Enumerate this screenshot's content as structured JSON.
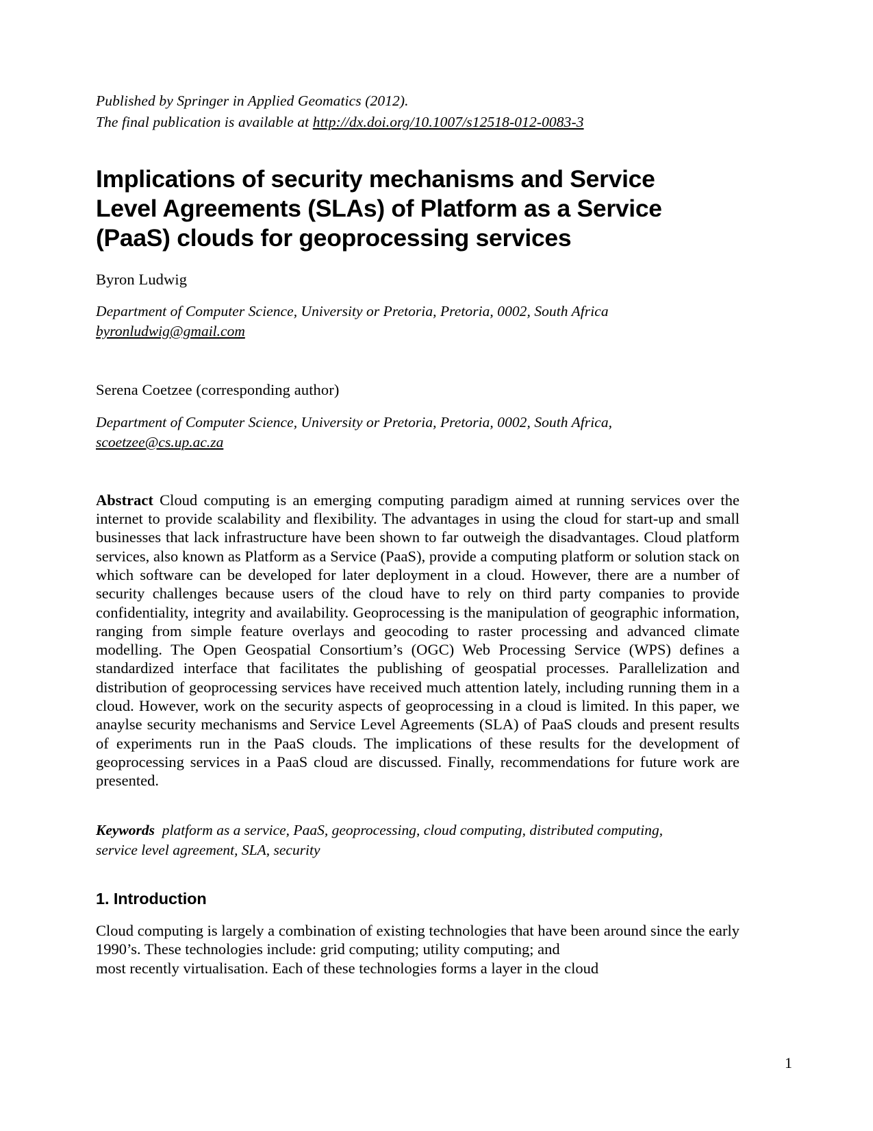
{
  "publication_header": {
    "line1": "Published by Springer in Applied Geomatics (2012).",
    "line2_prefix": "The final publication is available at ",
    "doi_url": "http://dx.doi.org/10.1007/s12518-012-0083-3"
  },
  "title": "Implications of security mechanisms and Service Level Agreements (SLAs) of Platform as a Service (PaaS) clouds for geoprocessing services",
  "authors": [
    {
      "name": "Byron Ludwig",
      "affiliation": "Department of Computer Science, University or Pretoria, Pretoria, 0002, South Africa",
      "email": "byronludwig@gmail.com"
    },
    {
      "name": "Serena Coetzee (corresponding author)",
      "affiliation": "Department of Computer Science, University or Pretoria, Pretoria, 0002, South Africa,",
      "email": "scoetzee@cs.up.ac.za"
    }
  ],
  "abstract": {
    "lead_label": "Abstract",
    "text": "Cloud computing is an emerging computing paradigm aimed at running services over the internet to provide scalability and flexibility. The advantages in using the cloud for start-up and small businesses that lack infrastructure have been shown to far outweigh the disadvantages. Cloud platform services, also known as Platform as a Service (PaaS), provide a computing platform or solution stack on which software can be developed for later deployment in a cloud. However, there are a number of security challenges because users of the cloud have to rely on third party companies to provide confidentiality, integrity and availability. Geoprocessing is the manipulation of geographic information, ranging from simple feature overlays and geocoding to raster processing and advanced climate modelling. The Open Geospatial Consortium’s (OGC) Web Processing Service (WPS) defines a standardized interface that facilitates the publishing of geospatial processes. Parallelization and distribution of geoprocessing services have received much attention lately, including running them in a cloud. However, work on the security aspects of geoprocessing in a cloud is limited. In this paper, we anaylse security mechanisms and Service Level Agreements (SLA) of PaaS clouds and present results of experiments run in the PaaS clouds. The implications of these results for the development of geoprocessing services in a PaaS cloud are discussed. Finally, recommendations for future work are presented."
  },
  "keywords": {
    "lead_label": "Keywords",
    "text": "platform as a service, PaaS, geoprocessing, cloud computing, distributed computing, service level agreement, SLA, security"
  },
  "section": {
    "heading": "1. Introduction",
    "paragraph_justified": "Cloud computing is largely a combination of existing technologies that have been around since the early 1990’s. These technologies include: grid computing; utility computing; and",
    "paragraph_last_line": "most   recently   virtualisation.   Each   of   these   technologies   forms   a   layer   in   the   cloud"
  },
  "page_number": "1"
}
